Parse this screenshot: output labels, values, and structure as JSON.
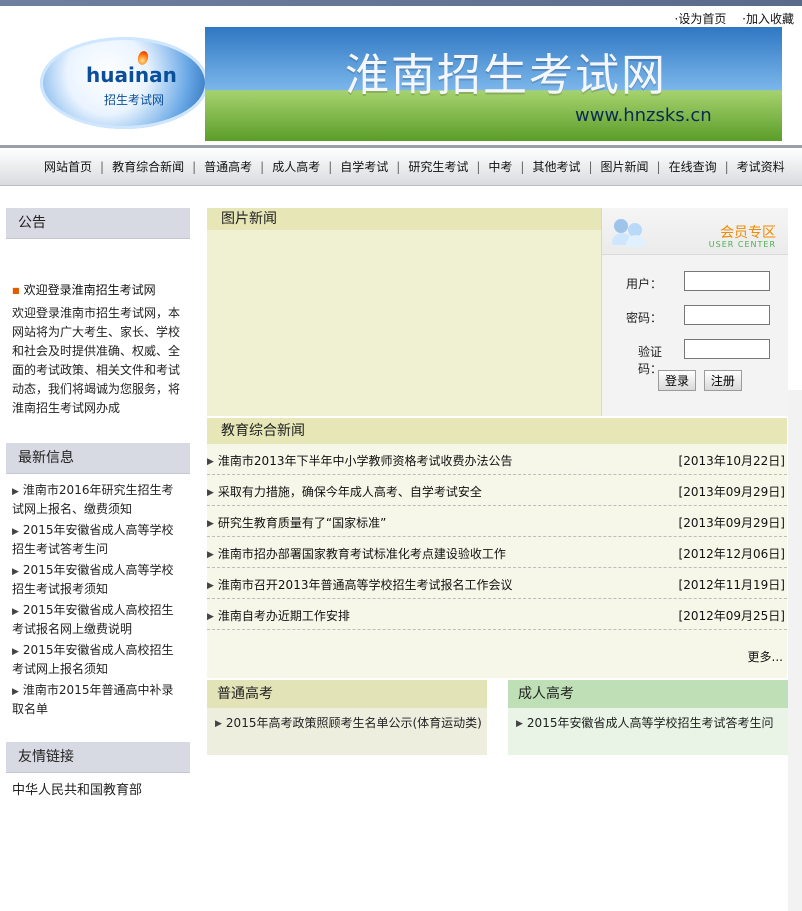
{
  "top_links": [
    "·设为首页",
    "·加入收藏"
  ],
  "logo": {
    "brand": "huainan",
    "subtitle": "招生考试网"
  },
  "banner": {
    "title": "淮南招生考试网",
    "url": "www.hnzsks.cn"
  },
  "nav": [
    "网站首页",
    "教育综合新闻",
    "普通高考",
    "成人高考",
    "自学考试",
    "研究生考试",
    "中考",
    "其他考试",
    "图片新闻",
    "在线查询",
    "考试资料"
  ],
  "sidebar": {
    "announce": {
      "title": "公告",
      "lead": "欢迎登录淮南招生考试网",
      "body": "欢迎登录淮南市招生考试网，本网站将为广大考生、家长、学校和社会及时提供准确、权威、全面的考试政策、相关文件和考试动态，我们将竭诚为您服务，将淮南招生考试网办成"
    },
    "latest": {
      "title": "最新信息",
      "items": [
        "淮南市2016年研究生招生考试网上报名、缴费须知",
        "2015年安徽省成人高等学校招生考试答考生问",
        "2015年安徽省成人高等学校招生考试报考须知",
        "2015年安徽省成人高校招生考试报名网上缴费说明",
        "2015年安徽省成人高校招生考试网上报名须知",
        "淮南市2015年普通高中补录取名单"
      ]
    },
    "friends": {
      "title": "友情链接",
      "first": "中华人民共和国教育部"
    }
  },
  "main": {
    "pic_news_title": "图片新闻",
    "member": {
      "zone_title": "会员专区",
      "zone_subtitle": "USER CENTER",
      "user_label": "用户：",
      "pass_label": "密码：",
      "captcha_label": "验证码：",
      "login": "登录",
      "register": "注册"
    },
    "edu_news": {
      "title": "教育综合新闻",
      "more": "更多...",
      "items": [
        {
          "text": "淮南市2013年下半年中小学教师资格考试收费办法公告",
          "date": "[2013年10月22日]"
        },
        {
          "text": "采取有力措施，确保今年成人高考、自学考试安全",
          "date": "[2013年09月29日]"
        },
        {
          "text": "研究生教育质量有了“国家标准”",
          "date": "[2013年09月29日]"
        },
        {
          "text": "淮南市招办部署国家教育考试标准化考点建设验收工作",
          "date": "[2012年12月06日]"
        },
        {
          "text": "淮南市召开2013年普通高等学校招生考试报名工作会议",
          "date": "[2012年11月19日]"
        },
        {
          "text": "淮南自考办近期工作安排",
          "date": "[2012年09月25日]"
        }
      ]
    },
    "bottom": {
      "left": {
        "title": "普通高考",
        "item": "2015年高考政策照顾考生名单公示(体育运动类)"
      },
      "right": {
        "title": "成人高考",
        "item": "2015年安徽省成人高等学校招生考试答考生问"
      }
    }
  }
}
